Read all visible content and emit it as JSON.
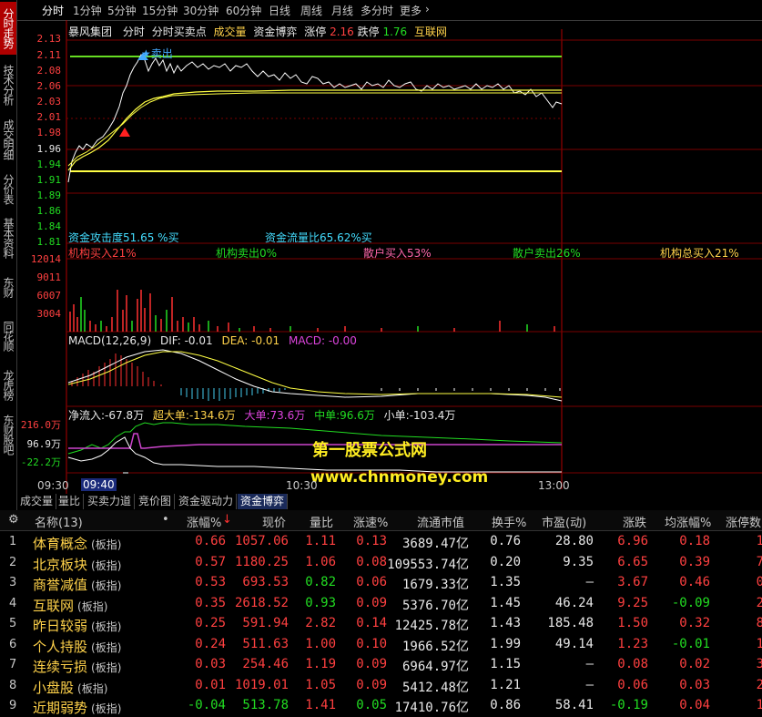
{
  "side_tabs": [
    "分时走势",
    "技术分析",
    "成交明细",
    "分价表",
    "基本资料",
    "东财10",
    "同花顺10",
    "龙虎榜",
    "东财股吧"
  ],
  "periods": [
    "分时",
    "1分钟",
    "5分钟",
    "15分钟",
    "30分钟",
    "60分钟",
    "日线",
    "周线",
    "月线",
    "多分时",
    "更多"
  ],
  "header": {
    "stock": "暴风集团",
    "t1": "分时",
    "t2": "分时买卖点",
    "t3": "成交量",
    "t4": "资金博弈",
    "zt_label": "涨停",
    "zt_val": "2.16",
    "dt_label": "跌停",
    "dt_val": "1.76",
    "hl": "互联网"
  },
  "sell_marker": "卖出",
  "price_labels": [
    "2.13",
    "2.11",
    "2.08",
    "2.06",
    "2.03",
    "2.01",
    "1.98",
    "1.96",
    "1.94",
    "1.91",
    "1.89",
    "1.86",
    "1.84",
    "1.81"
  ],
  "attack_text": "资金攻击度51.65 %买",
  "flow_text": "资金流量比65.62%买",
  "institution": [
    "机构买入21%",
    "机构卖出0%",
    "散户买入53%",
    "散户卖出26%",
    "机构总买入21%"
  ],
  "vol_labels": [
    "12014",
    "9011",
    "6007",
    "3004"
  ],
  "macd": {
    "title": "MACD(12,26,9)",
    "dif": "DIF: -0.01",
    "dea": "DEA: -0.01",
    "macd": "MACD: -0.00"
  },
  "flow": {
    "net": "净流入:-67.8万",
    "huge": "超大单:-134.6万",
    "big": "大单:73.6万",
    "mid": "中单:96.6万",
    "small": "小单:-103.4万"
  },
  "flow_labels": [
    "216.0万",
    "96.9万",
    "-22.2万"
  ],
  "watermark": {
    "line1": "第一股票公式网",
    "line2": "www.chnmoney.com"
  },
  "time_labels": [
    "09:30",
    "09:40",
    "10:30",
    "13:00"
  ],
  "bottom_tabs": [
    "成交量",
    "量比",
    "买卖力道",
    "竞价图",
    "资金驱动力",
    "资金博弈"
  ],
  "table": {
    "headers": [
      "名称(13)",
      "•",
      "涨幅%",
      "现价",
      "量比",
      "涨速%",
      "流通市值",
      "换手%",
      "市盈(动)",
      "涨跌",
      "均涨幅%",
      "涨停数"
    ],
    "tag": "(板指)",
    "rows": [
      {
        "i": "1",
        "name": "体育概念",
        "chg": "0.66",
        "price": "1057.06",
        "lb": "1.11",
        "spd": "0.13",
        "cap": "3689.47亿",
        "turn": "0.76",
        "pe": "28.80",
        "d": "6.96",
        "avg": "0.18",
        "zt": "1"
      },
      {
        "i": "2",
        "name": "北京板块",
        "chg": "0.57",
        "price": "1180.25",
        "lb": "1.06",
        "spd": "0.08",
        "cap": "109553.74亿",
        "turn": "0.20",
        "pe": "9.35",
        "d": "6.65",
        "avg": "0.39",
        "zt": "7"
      },
      {
        "i": "3",
        "name": "商誉减值",
        "chg": "0.53",
        "price": "693.53",
        "lb": "0.82",
        "spd": "0.06",
        "cap": "1679.33亿",
        "turn": "1.35",
        "pe": "–",
        "d": "3.67",
        "avg": "0.46",
        "zt": "0"
      },
      {
        "i": "4",
        "name": "互联网",
        "chg": "0.35",
        "price": "2618.52",
        "lb": "0.93",
        "spd": "0.09",
        "cap": "5376.70亿",
        "turn": "1.45",
        "pe": "46.24",
        "d": "9.25",
        "avg": "-0.09",
        "zt": "2"
      },
      {
        "i": "5",
        "name": "昨日较弱",
        "chg": "0.25",
        "price": "591.94",
        "lb": "2.82",
        "spd": "0.14",
        "cap": "12425.78亿",
        "turn": "1.43",
        "pe": "185.48",
        "d": "1.50",
        "avg": "0.32",
        "zt": "8"
      },
      {
        "i": "6",
        "name": "个人持股",
        "chg": "0.24",
        "price": "511.63",
        "lb": "1.00",
        "spd": "0.10",
        "cap": "1966.52亿",
        "turn": "1.99",
        "pe": "49.14",
        "d": "1.23",
        "avg": "-0.01",
        "zt": "1"
      },
      {
        "i": "7",
        "name": "连续亏损",
        "chg": "0.03",
        "price": "254.46",
        "lb": "1.19",
        "spd": "0.09",
        "cap": "6964.97亿",
        "turn": "1.15",
        "pe": "–",
        "d": "0.08",
        "avg": "0.02",
        "zt": "3"
      },
      {
        "i": "8",
        "name": "小盘股",
        "chg": "0.01",
        "price": "1019.01",
        "lb": "1.05",
        "spd": "0.09",
        "cap": "5412.48亿",
        "turn": "1.21",
        "pe": "–",
        "d": "0.06",
        "avg": "0.03",
        "zt": "2"
      },
      {
        "i": "9",
        "name": "近期弱势",
        "chg": "-0.04",
        "price": "513.78",
        "lb": "1.41",
        "spd": "0.05",
        "cap": "17410.76亿",
        "turn": "0.86",
        "pe": "58.41",
        "d": "-0.19",
        "avg": "0.04",
        "zt": "1"
      }
    ]
  }
}
